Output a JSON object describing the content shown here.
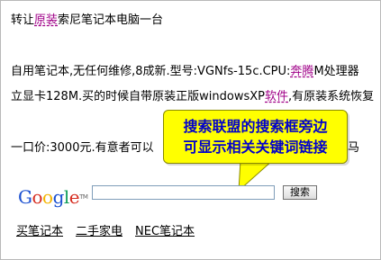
{
  "post": {
    "title_prefix": "转让",
    "title_kw": "原装",
    "title_suffix": "索尼笔记本电脑一台",
    "line1_a": "自用笔记本,无任何维修,8成新.型号:VGNfs-15c.CPU:",
    "line1_kw": "奔腾",
    "line1_b": "M处理器",
    "line2_a": "立显卡128M.买的时候自带原装正版windowsXP",
    "line2_kw": "软件",
    "line2_b": ",有原装系统恢复",
    "price_a": "一口价:3000元.有意者可以",
    "price_b": "马"
  },
  "callout": {
    "line1": "搜索联盟的搜索框旁边",
    "line2": "可显示相关关键词链接",
    "color": "#ffff00",
    "text_color": "#0000cc"
  },
  "search": {
    "logo_text": "Google",
    "logo_tm": "TM",
    "input_value": "",
    "button_label": "搜索"
  },
  "related_links": [
    "买笔记本",
    "二手家电",
    "NEC笔记本"
  ]
}
